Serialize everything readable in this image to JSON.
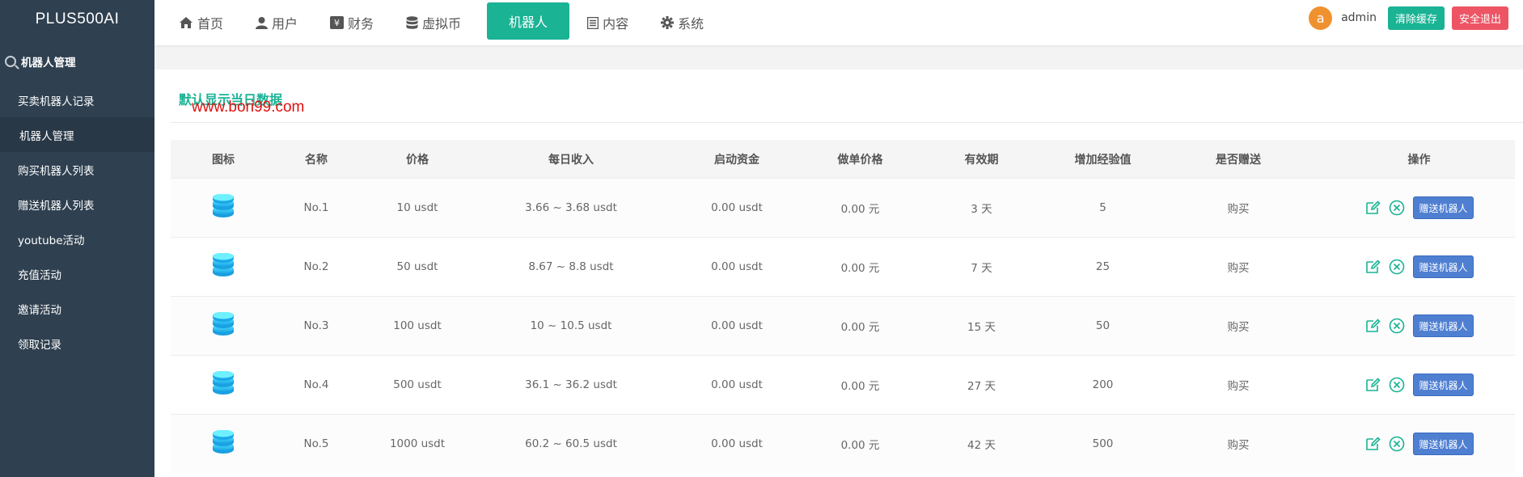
{
  "brand": "PLUS500AI",
  "sidebar": {
    "section": "机器人管理",
    "items": [
      {
        "label": "买卖机器人记录"
      },
      {
        "label": "机器人管理"
      },
      {
        "label": "购买机器人列表"
      },
      {
        "label": "赠送机器人列表"
      },
      {
        "label": "youtube活动"
      },
      {
        "label": "充值活动"
      },
      {
        "label": "邀请活动"
      },
      {
        "label": "领取记录"
      }
    ]
  },
  "nav": {
    "items": [
      {
        "label": "首页",
        "icon": "home-icon"
      },
      {
        "label": "用户",
        "icon": "user-icon"
      },
      {
        "label": "财务",
        "icon": "finance-icon"
      },
      {
        "label": "虚拟币",
        "icon": "database-icon"
      },
      {
        "label": "机器人",
        "icon": ""
      },
      {
        "label": "内容",
        "icon": "content-icon"
      },
      {
        "label": "系统",
        "icon": "gear-icon"
      }
    ]
  },
  "header": {
    "avatar_letter": "a",
    "username": "admin",
    "clear_cache": "清除缓存",
    "logout": "安全退出"
  },
  "content": {
    "title": "默认显示当日数据",
    "watermark": "www.bori99.com"
  },
  "table": {
    "headers": [
      "图标",
      "名称",
      "价格",
      "每日收入",
      "启动资金",
      "做单价格",
      "有效期",
      "增加经验值",
      "是否赠送",
      "操作"
    ],
    "gift_label": "赠送机器人",
    "rows": [
      {
        "name": "No.1",
        "price": "10 usdt",
        "daily": "3.66 ~ 3.68 usdt",
        "start": "0.00 usdt",
        "order": "0.00 元",
        "valid": "3 天",
        "exp": "5",
        "gift": "购买"
      },
      {
        "name": "No.2",
        "price": "50 usdt",
        "daily": "8.67 ~ 8.8 usdt",
        "start": "0.00 usdt",
        "order": "0.00 元",
        "valid": "7 天",
        "exp": "25",
        "gift": "购买"
      },
      {
        "name": "No.3",
        "price": "100 usdt",
        "daily": "10 ~ 10.5 usdt",
        "start": "0.00 usdt",
        "order": "0.00 元",
        "valid": "15 天",
        "exp": "50",
        "gift": "购买"
      },
      {
        "name": "No.4",
        "price": "500 usdt",
        "daily": "36.1 ~ 36.2 usdt",
        "start": "0.00 usdt",
        "order": "0.00 元",
        "valid": "27 天",
        "exp": "200",
        "gift": "购买"
      },
      {
        "name": "No.5",
        "price": "1000 usdt",
        "daily": "60.2 ~ 60.5 usdt",
        "start": "0.00 usdt",
        "order": "0.00 元",
        "valid": "42 天",
        "exp": "500",
        "gift": "购买"
      }
    ]
  },
  "colors": {
    "sidebar_bg": "#2f4050",
    "accent": "#1ab394",
    "danger": "#ed5565",
    "avatar": "#f0912f",
    "gift_button": "#4f7fd1",
    "watermark": "#e01010"
  }
}
